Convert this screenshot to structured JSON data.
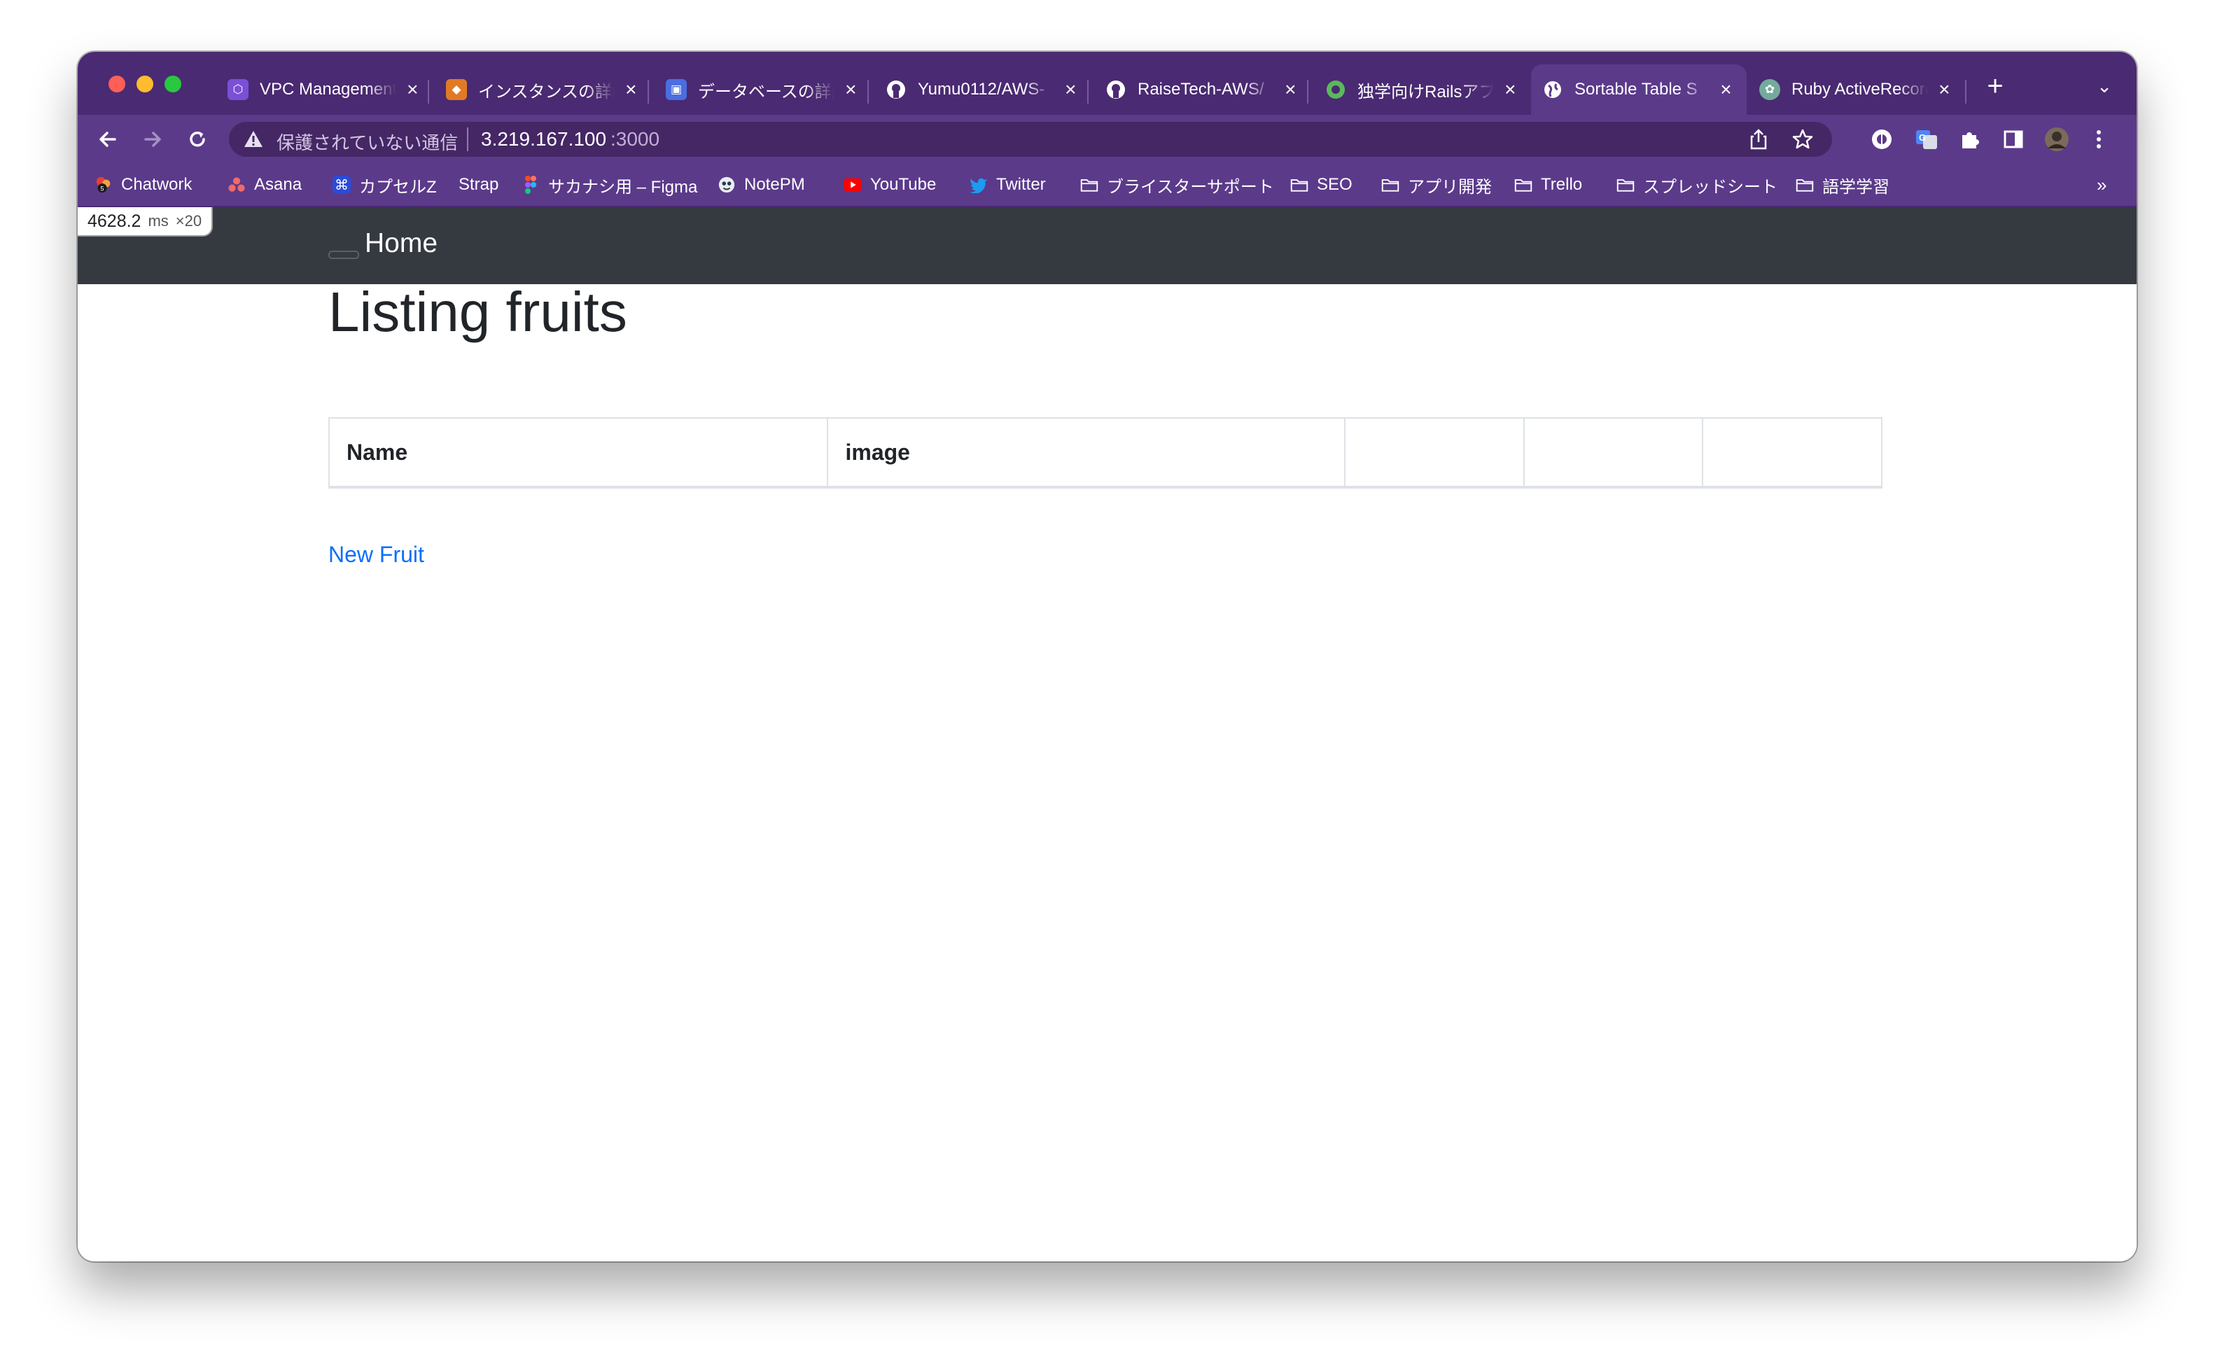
{
  "browser": {
    "tabs": [
      {
        "title": "VPC Management Console",
        "favicon": "aws-vpc-icon",
        "favicon_color": "#7b4fd6",
        "active": false
      },
      {
        "title": "インスタンスの詳細",
        "favicon": "aws-ec2-icon",
        "favicon_color": "#e07b24",
        "active": false
      },
      {
        "title": "データベースの詳細",
        "favicon": "aws-rds-icon",
        "favicon_color": "#4a6ee0",
        "active": false
      },
      {
        "title": "Yumu0112/AWS-",
        "favicon": "github-icon",
        "favicon_color": "#ffffff",
        "active": false
      },
      {
        "title": "RaiseTech-AWS/",
        "favicon": "github-icon",
        "favicon_color": "#ffffff",
        "active": false
      },
      {
        "title": "独学向けRailsアプ",
        "favicon": "green-circle-icon",
        "favicon_color": "#5cb85c",
        "active": false
      },
      {
        "title": "Sortable Table S",
        "favicon": "globe-icon",
        "favicon_color": "#ffffff",
        "active": true
      },
      {
        "title": "Ruby ActiveRecord",
        "favicon": "chatgpt-icon",
        "favicon_color": "#74aa9c",
        "active": false
      }
    ],
    "address": {
      "security_label": "保護されていない通信",
      "host": "3.219.167.100",
      "port": ":3000"
    },
    "bookmarks": [
      {
        "label": "Chatwork",
        "icon": "chatwork-icon"
      },
      {
        "label": "Asana",
        "icon": "asana-icon"
      },
      {
        "label": "カプセルZ",
        "icon": "command-icon"
      },
      {
        "label": "Strap",
        "icon": ""
      },
      {
        "label": "サカナシ用 – Figma",
        "icon": "figma-icon"
      },
      {
        "label": "NotePM",
        "icon": "notepm-icon"
      },
      {
        "label": "YouTube",
        "icon": "youtube-icon"
      },
      {
        "label": "Twitter",
        "icon": "twitter-icon"
      },
      {
        "label": "ブライスターサポート",
        "icon": "folder-icon"
      },
      {
        "label": "SEO",
        "icon": "folder-icon"
      },
      {
        "label": "アプリ開発",
        "icon": "folder-icon"
      },
      {
        "label": "Trello",
        "icon": "folder-icon"
      },
      {
        "label": "スプレッドシート",
        "icon": "folder-icon"
      },
      {
        "label": "語学学習",
        "icon": "folder-icon"
      }
    ],
    "bookmarks_overflow": "»",
    "accent": "#5b3a8a"
  },
  "perf_badge": {
    "ms_value": "4628.2",
    "unit": "ms",
    "multiplier": "×20"
  },
  "navbar": {
    "brand": "Home"
  },
  "page": {
    "heading": "Listing fruits",
    "table_headers": [
      "Name",
      "image",
      "",
      "",
      ""
    ],
    "new_link": "New Fruit",
    "link_color": "#0d6efd"
  }
}
